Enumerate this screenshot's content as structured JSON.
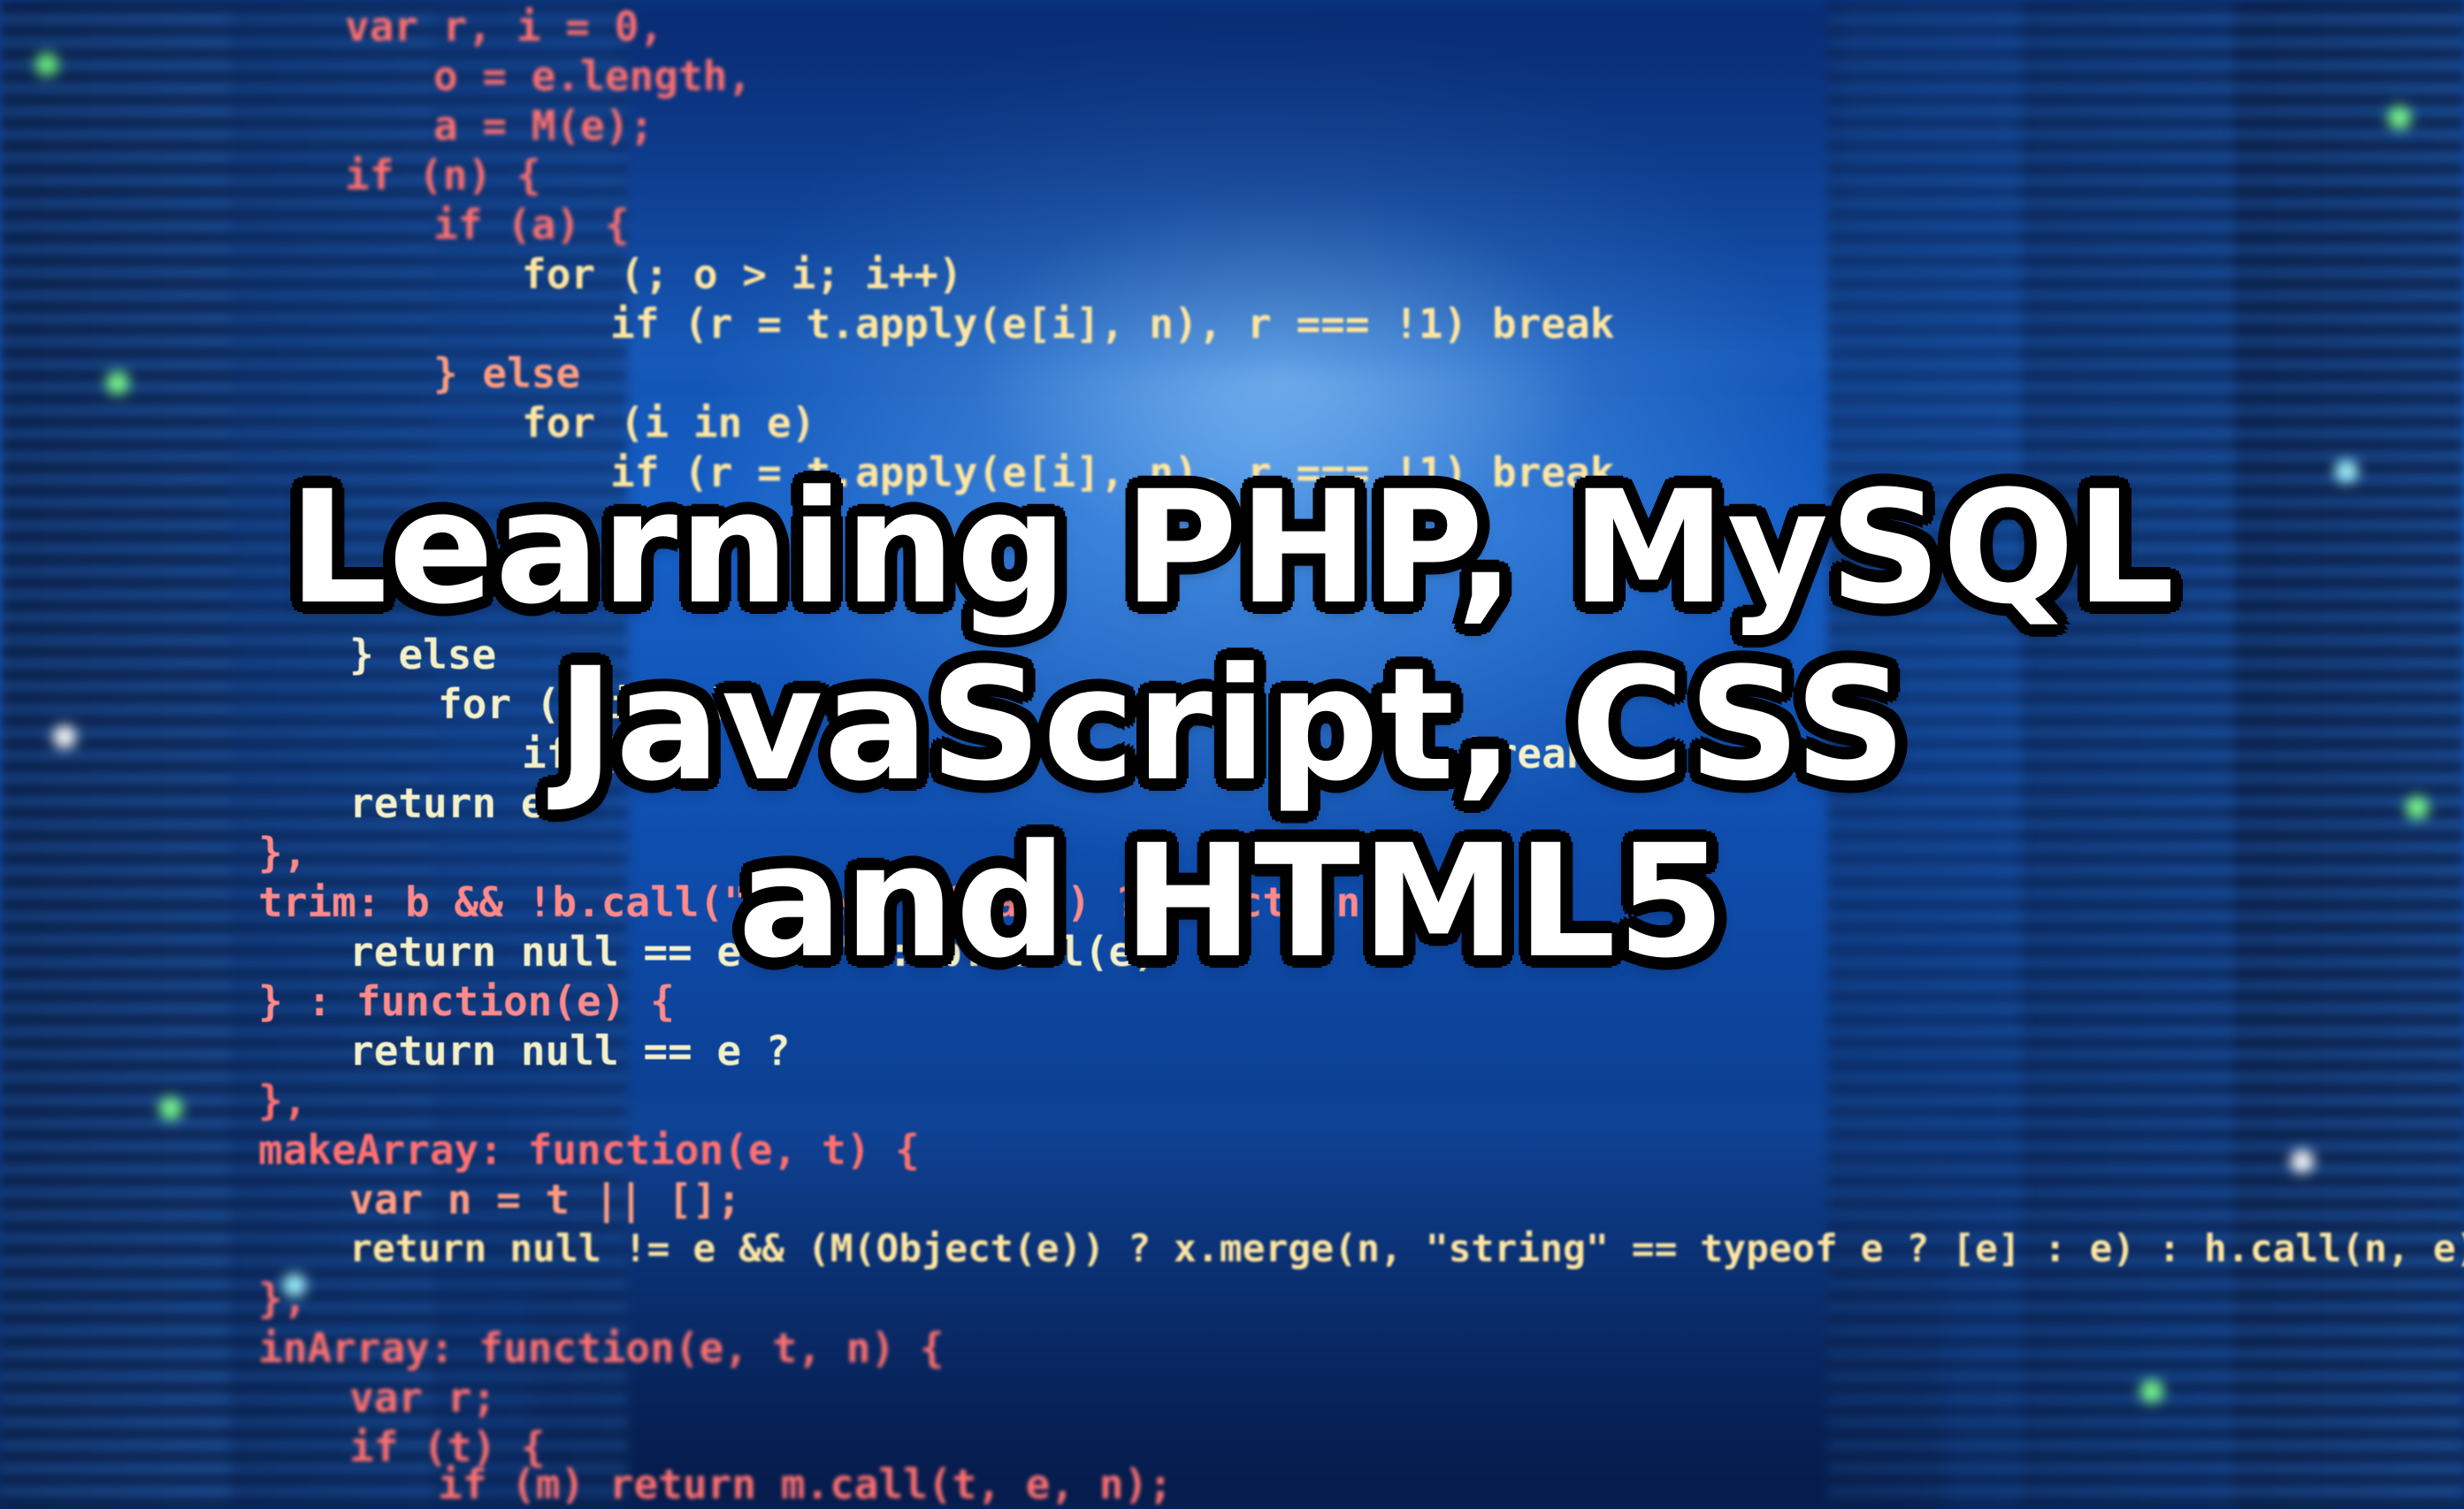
{
  "title": {
    "line1": "Learning PHP, MySQL",
    "line2": "JavaScript, CSS",
    "line3": "and HTML5"
  },
  "code_lines": [
    "var r, i = 0,",
    "o = e.length,",
    "a = M(e);",
    "if (n) {",
    "if (a) {",
    "for (; o > i; i++)",
    "if (r = t.apply(e[i], n), r === !1) break",
    "} else",
    "for (i in e)",
    "if (r = t.apply(e[i], n), r === !1) break",
    "} else",
    "for (i in e)",
    "if (r",
    "break;",
    "return e",
    "},",
    "trim: b && !b.call(\"\\ufeff\\u00a0\") ? function(e) {",
    "return null == e ? \"\" : b.call(e)",
    "} : function(e) {",
    "return null == e ?",
    "},",
    "makeArray: function(e, t) {",
    "var n = t || [];",
    "return null != e && (M(Object(e)) ? x.merge(n, \"string\" == typeof e ? [e] : e) : h.call(n, e)),",
    "},",
    "inArray: function(e, t, n) {",
    "var r;",
    "if (t) {",
    "if (m) return m.call(t, e, n);"
  ],
  "colors": {
    "code_keyword": "#ff6a6a",
    "code_text": "#f4f0c8",
    "title_fill": "#ffffff",
    "title_outline": "#000000",
    "background": "#1660c8"
  }
}
